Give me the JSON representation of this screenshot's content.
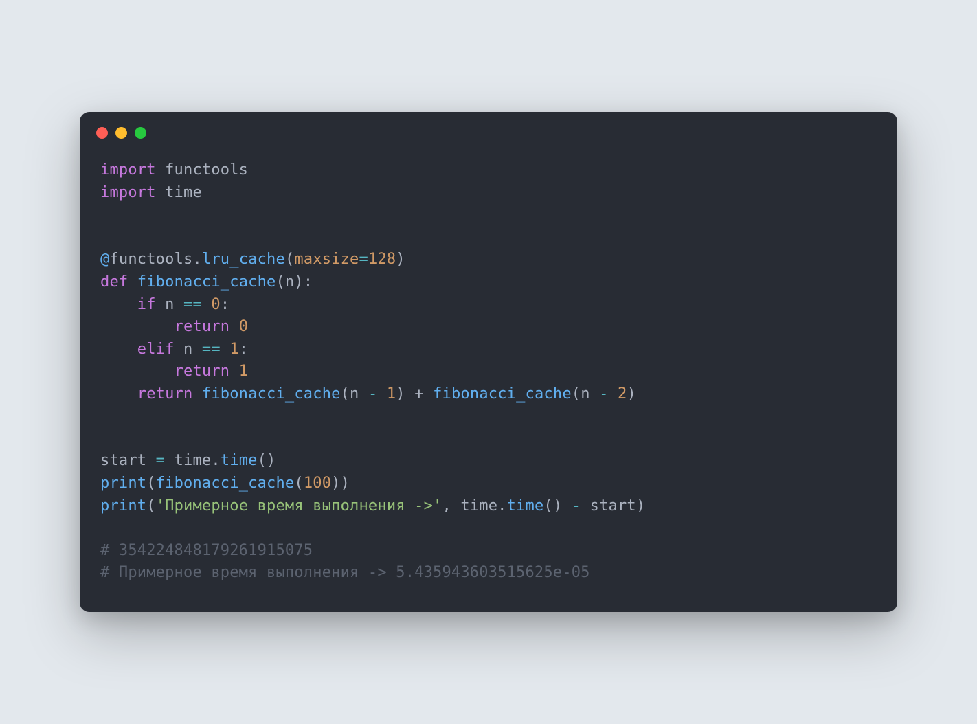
{
  "traffic": {
    "close": "close",
    "min": "minimize",
    "max": "zoom"
  },
  "code": {
    "l1_import": "import",
    "l1_mod": " functools",
    "l2_import": "import",
    "l2_mod": " time",
    "l4_at": "@",
    "l4_functools": "functools",
    "l4_dot": ".",
    "l4_lru": "lru_cache",
    "l4_open": "(",
    "l4_arg": "maxsize",
    "l4_eq": "=",
    "l4_num": "128",
    "l4_close": ")",
    "l5_def": "def",
    "l5_space": " ",
    "l5_name": "fibonacci_cache",
    "l5_open": "(",
    "l5_param": "n",
    "l5_close": "):",
    "l6_if": "if",
    "l6_rest": " n ",
    "l6_eq": "==",
    "l6_space": " ",
    "l6_zero": "0",
    "l6_colon": ":",
    "l7_return": "return",
    "l7_space": " ",
    "l7_zero": "0",
    "l8_elif": "elif",
    "l8_rest": " n ",
    "l8_eq": "==",
    "l8_space": " ",
    "l8_one": "1",
    "l8_colon": ":",
    "l9_return": "return",
    "l9_space": " ",
    "l9_one": "1",
    "l10_return": "return",
    "l10_space": " ",
    "l10_fib1": "fibonacci_cache",
    "l10_open1": "(",
    "l10_n1": "n ",
    "l10_minus1": "-",
    "l10_sp1": " ",
    "l10_one": "1",
    "l10_close1": ")",
    "l10_plus": " + ",
    "l10_fib2": "fibonacci_cache",
    "l10_open2": "(",
    "l10_n2": "n ",
    "l10_minus2": "-",
    "l10_sp2": " ",
    "l10_two": "2",
    "l10_close2": ")",
    "l13_start": "start ",
    "l13_eq": "=",
    "l13_sp": " ",
    "l13_time1": "time",
    "l13_dot": ".",
    "l13_time2": "time",
    "l13_call": "()",
    "l14_print": "print",
    "l14_open": "(",
    "l14_fib": "fibonacci_cache",
    "l14_open2": "(",
    "l14_num": "100",
    "l14_close": "))",
    "l15_print": "print",
    "l15_open": "(",
    "l15_str": "'Примерное время выполнения ->'",
    "l15_comma": ", ",
    "l15_time1": "time",
    "l15_dot": ".",
    "l15_time2": "time",
    "l15_call": "()",
    "l15_sp": " ",
    "l15_minus": "-",
    "l15_sp2": " ",
    "l15_start": "start",
    "l15_close": ")",
    "l17_comment": "# 354224848179261915075",
    "l18_comment": "# Примерное время выполнения -> 5.435943603515625e-05"
  }
}
